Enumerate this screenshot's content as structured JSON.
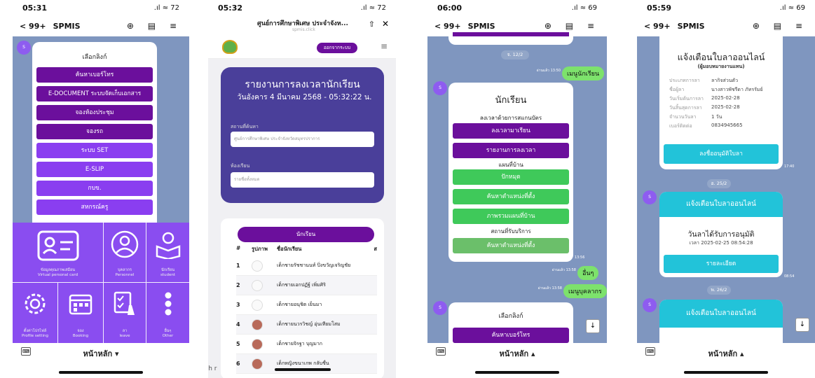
{
  "p1": {
    "time": "05:31",
    "signal": ".ıl ≈ 72",
    "back": "< 99+",
    "name": "SPMIS",
    "nav_icons": "⊕ ▤ ≡",
    "card_title": "เลือกลิงก์",
    "buttons": [
      "ค้นหาเบอร์โทร",
      "E-DOCUMENT ระบบจัดเก็บเอกสาร",
      "จองห้องประชุม",
      "จองรถ",
      "ระบบ SET",
      "E-SLIP",
      "กบข.",
      "สหกรณ์ครู"
    ],
    "tiles": [
      {
        "l1": "ข้อมูลคุณภาพเสมือน",
        "l2": "Virtual personal card"
      },
      {
        "l1": "บุคลากร",
        "l2": "Personnel"
      },
      {
        "l1": "นักเรียน",
        "l2": "student"
      },
      {
        "l1": "ตั้งค่าโปรไฟล์",
        "l2": "Profile setting"
      },
      {
        "l1": "จอง",
        "l2": "Booking"
      },
      {
        "l1": "ลา",
        "l2": "leave"
      },
      {
        "l1": "อื่นๆ",
        "l2": "Other"
      }
    ],
    "home": "หน้าหลัก ▾"
  },
  "p2": {
    "time": "05:32",
    "signal": ".ıl ≈ 72",
    "url_title": "ศูนย์การศึกษาพิเศษ ประจำจังห...",
    "url_sub": "spmis.click",
    "logout": "ออกจากระบบ",
    "report_title": "รายงานการลงเวลานักเรียน",
    "report_date": "วันอังคาร 4 มีนาคม 2568 - 05:32:22 น.",
    "label_school": "สถานที่ค้นหา",
    "school_value": "ศูนย์การศึกษาพิเศษ ประจำจังหวัดสมุทรปราการ",
    "label_room": "ห้องเรียน",
    "room_value": "รายชื่อทั้งหมด",
    "tab": "นักเรียน",
    "cols": [
      "#",
      "รูปภาพ",
      "ชื่อนักเรียน",
      "ส"
    ],
    "students": [
      {
        "no": "1",
        "name": "เด็กชายรัชชานนท์ ปิ่งขวัญเจริญชัย"
      },
      {
        "no": "2",
        "name": "เด็กชายเอกปฏัฐ์ เพิ่มศิริ"
      },
      {
        "no": "3",
        "name": "เด็กชายอนุชิต เย็นมา"
      },
      {
        "no": "4",
        "name": "เด็กชายนวรวิชญ์ อุ่นเทียมโสม"
      },
      {
        "no": "5",
        "name": "เด็กชายจิรฐา บุญมาก"
      },
      {
        "no": "6",
        "name": "เด็กหญิงขนาเกพ กลับชื่น"
      }
    ],
    "search_hint": "Search r"
  },
  "p3": {
    "time": "06:00",
    "signal": ".ıl ≈ 69",
    "back": "< 99+",
    "name": "SPMIS",
    "nav_icons": "⊕ ▤ ≡",
    "date_pill": "จ. 12/2",
    "msg1": "เมนูนักเรียน",
    "msg1_ts": "อ่านแล้ว 13:50",
    "card_title": "นักเรียน",
    "sec1": "ลงเวลาด้วยการสแกนบัตร",
    "btn_a": [
      "ลงเวลามาเรียน",
      "รายงานการลงเวลา"
    ],
    "sec2": "แผนที่บ้าน",
    "btn_b": [
      "ปักหมุด",
      "ค้นหาตำแหน่งที่ตั้ง",
      "ภาพรวมแผนที่บ้าน"
    ],
    "sec3": "สถานที่รับบริการ",
    "btn_c": "ค้นหาตำแหน่งที่ตั้ง",
    "card_ts": "13:56",
    "msg2": "อื่นๆ",
    "msg2_ts": "อ่านแล้ว 13:58",
    "msg3": "เมนูบุคลากร",
    "msg3_ts": "อ่านแล้ว 13:58",
    "card2_title": "เลือกลิงก์",
    "card2_btn": "ค้นหาเบอร์โทร",
    "home": "หน้าหลัก ▴"
  },
  "p4": {
    "time": "05:59",
    "signal": ".ıl ≈ 69",
    "back": "< 99+",
    "name": "SPMIS",
    "nav_icons": "⊕ ▤ ≡",
    "card_title": "แจ้งเตือนใบลาออนไลน์",
    "card_sub": "(ผู้มอบหมายงานแทน)",
    "rows": [
      {
        "k": "ประเภทการลา",
        "v": "ลากิจส่วนตัว"
      },
      {
        "k": "ชื่อผู้ลา",
        "v": "นางสาวพัชรีดา ภัทรรัมย์"
      },
      {
        "k": "วันเริ่มต้นการลา",
        "v": "2025-02-28"
      },
      {
        "k": "วันสิ้นสุดการลา",
        "v": "2025-02-28"
      },
      {
        "k": "จำนวนวันลา",
        "v": "1 วัน"
      },
      {
        "k": "เบอร์ติดต่อ",
        "v": "0834945665"
      }
    ],
    "approve": "ลงชื่ออนุมัติใบลา",
    "ts1": "17:40",
    "pill1": "อ. 25/2",
    "head2": "แจ้งเตือนใบลาออนไลน์",
    "approved": "วันลาได้รับการอนุมัติ",
    "approved_time": "เวลา 2025-02-25 08:54:28",
    "detail": "รายละเอียด",
    "ts2": "08:54",
    "pill2": "พ. 26/2",
    "head3": "แจ้งเตือนใบลาออนไลน์",
    "home": "หน้าหลัก ▴"
  },
  "colors": {
    "purple_dark": "#6b0f9c",
    "purple_light": "#8a4df0",
    "green": "#3fc95a",
    "teal": "#22c3d9",
    "chat_bg": "#7f96bf",
    "navy": "#4a3f9a"
  }
}
